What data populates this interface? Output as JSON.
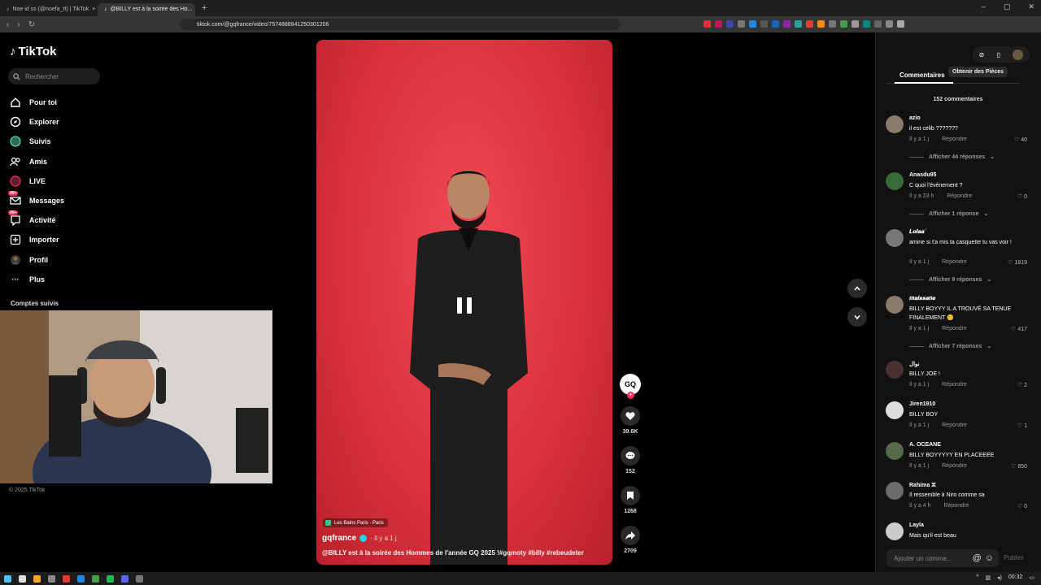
{
  "browser": {
    "tabs": [
      {
        "title": "Noe id ss (@noefa_tt) | TikTok",
        "active": false
      },
      {
        "title": "@BILLY est à la soirée des Ho...",
        "active": true
      }
    ],
    "url": "tiktok.com/@gqfrance/video/7574888941250301206"
  },
  "sidebar": {
    "logo": "TikTok",
    "search_placeholder": "Rechercher",
    "items": [
      {
        "label": "Pour toi",
        "icon": "home-icon",
        "badge": ""
      },
      {
        "label": "Explorer",
        "icon": "compass-icon",
        "badge": ""
      },
      {
        "label": "Suivis",
        "icon": "following-avatar-icon",
        "badge": ""
      },
      {
        "label": "Amis",
        "icon": "friends-icon",
        "badge": ""
      },
      {
        "label": "LIVE",
        "icon": "live-icon",
        "badge": ""
      },
      {
        "label": "Messages",
        "icon": "messages-icon",
        "badge": "99+"
      },
      {
        "label": "Activité",
        "icon": "activity-icon",
        "badge": "99+"
      },
      {
        "label": "Importer",
        "icon": "upload-icon",
        "badge": ""
      },
      {
        "label": "Profil",
        "icon": "profile-avatar-icon",
        "badge": ""
      },
      {
        "label": "Plus",
        "icon": "more-icon",
        "badge": ""
      }
    ],
    "followed_accounts_title": "Comptes suivis",
    "copyright": "© 2025 TikTok"
  },
  "video": {
    "location": "Les Bains Paris · Paris",
    "author": "gqfrance",
    "date": "· Il y a 1 j",
    "caption": "@BILLY est à la soirée des Hommes de l'année GQ 2025 !#gqmoty #billy #rebeudeter",
    "author_avatar_text": "GQ"
  },
  "actions": {
    "likes": "39.6K",
    "comments": "152",
    "saves": "1268",
    "shares": "2709"
  },
  "panel": {
    "tooltip": "Obtenir des Pièces",
    "tab_comments": "Commentaires",
    "comment_count": "152 commentaires",
    "reply_label": "Répondre",
    "comments": [
      {
        "user": "azio",
        "text": "il est celib ???????",
        "time": "Il y a 1 j",
        "likes": "40",
        "replies": "Afficher 44 réponses"
      },
      {
        "user": "Anasdu95",
        "text": "C quoi l'événement ?",
        "time": "Il y a 23 h",
        "likes": "0",
        "replies": "Afficher 1 réponse"
      },
      {
        "user": "𝑳𝒐𝒍𝒂𝒂 ̈",
        "text": "amine si t'a mis ta casquette tu vas voir !",
        "time": "Il y a 1 j",
        "likes": "1819",
        "replies": "Afficher 9 réponses"
      },
      {
        "user": "𝒎𝒂𝒊𝒔𝒔𝒂𝒏𝒆",
        "text": "BILLY BOYYY IL A TROUVÉ SA TENUE FINALEMENT 😊",
        "time": "Il y a 1 j",
        "likes": "417",
        "replies": "Afficher 7 réponses"
      },
      {
        "user": "نوال",
        "text": "BILLY JOE !",
        "time": "Il y a 1 j",
        "likes": "2",
        "replies": ""
      },
      {
        "user": "Jiren1910",
        "text": "BILLY BOY",
        "time": "Il y a 1 j",
        "likes": "1",
        "replies": ""
      },
      {
        "user": "A. OCEANE",
        "text": "BILLY BOYYYYY EN PLACEEEE",
        "time": "Il y a 1 j",
        "likes": "850",
        "replies": ""
      },
      {
        "user": "Rahima ⵣ",
        "text": "Il ressemble à Niro comme sa",
        "time": "Il y a 4 h",
        "likes": "0",
        "replies": ""
      },
      {
        "user": "Layla",
        "text": "Mais qu'il est beau",
        "time": "",
        "likes": "",
        "replies": ""
      }
    ],
    "input_placeholder": "Ajouter un comme...",
    "publish_label": "Publier"
  },
  "taskbar": {
    "time": "00:32"
  }
}
